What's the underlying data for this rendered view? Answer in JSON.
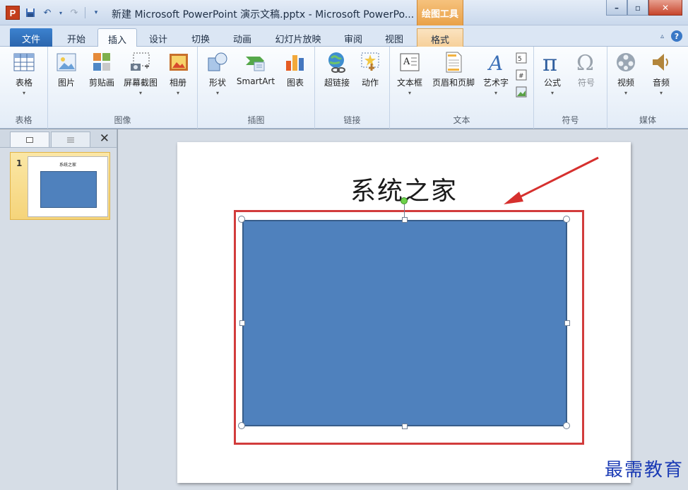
{
  "window": {
    "title": "新建 Microsoft PowerPoint 演示文稿.pptx - Microsoft PowerPo...",
    "context_tab_group": "绘图工具",
    "app_icon_letter": "P"
  },
  "tabs": [
    {
      "label": "文件"
    },
    {
      "label": "开始"
    },
    {
      "label": "插入"
    },
    {
      "label": "设计"
    },
    {
      "label": "切换"
    },
    {
      "label": "动画"
    },
    {
      "label": "幻灯片放映"
    },
    {
      "label": "审阅"
    },
    {
      "label": "视图"
    },
    {
      "label": "格式"
    }
  ],
  "active_tab": "插入",
  "ribbon": {
    "groups": [
      {
        "label": "表格",
        "buttons": [
          {
            "label": "表格",
            "icon": "table-icon"
          }
        ]
      },
      {
        "label": "图像",
        "buttons": [
          {
            "label": "图片",
            "icon": "picture-icon"
          },
          {
            "label": "剪贴画",
            "icon": "clipart-icon"
          },
          {
            "label": "屏幕截图",
            "icon": "screenshot-icon"
          },
          {
            "label": "相册",
            "icon": "photo-album-icon"
          }
        ]
      },
      {
        "label": "插图",
        "buttons": [
          {
            "label": "形状",
            "icon": "shapes-icon"
          },
          {
            "label": "SmartArt",
            "icon": "smartart-icon"
          },
          {
            "label": "图表",
            "icon": "chart-icon"
          }
        ]
      },
      {
        "label": "链接",
        "buttons": [
          {
            "label": "超链接",
            "icon": "hyperlink-icon"
          },
          {
            "label": "动作",
            "icon": "action-icon"
          }
        ]
      },
      {
        "label": "文本",
        "buttons": [
          {
            "label": "文本框",
            "icon": "textbox-icon"
          },
          {
            "label": "页眉和页脚",
            "icon": "header-footer-icon"
          },
          {
            "label": "艺术字",
            "icon": "wordart-icon"
          }
        ]
      },
      {
        "label": "符号",
        "buttons": [
          {
            "label": "公式",
            "icon": "equation-icon"
          },
          {
            "label": "符号",
            "icon": "symbol-icon"
          }
        ]
      },
      {
        "label": "媒体",
        "buttons": [
          {
            "label": "视频",
            "icon": "video-icon"
          },
          {
            "label": "音频",
            "icon": "audio-icon"
          }
        ]
      }
    ]
  },
  "thumbnails": [
    {
      "number": "1",
      "title": "系统之家"
    }
  ],
  "slide": {
    "title": "系统之家"
  },
  "colors": {
    "shape_fill": "#4f81bd",
    "shape_border": "#385d8a",
    "highlight": "#d23c3c",
    "context_tab": "#e9a148"
  },
  "watermark": "最需教育"
}
